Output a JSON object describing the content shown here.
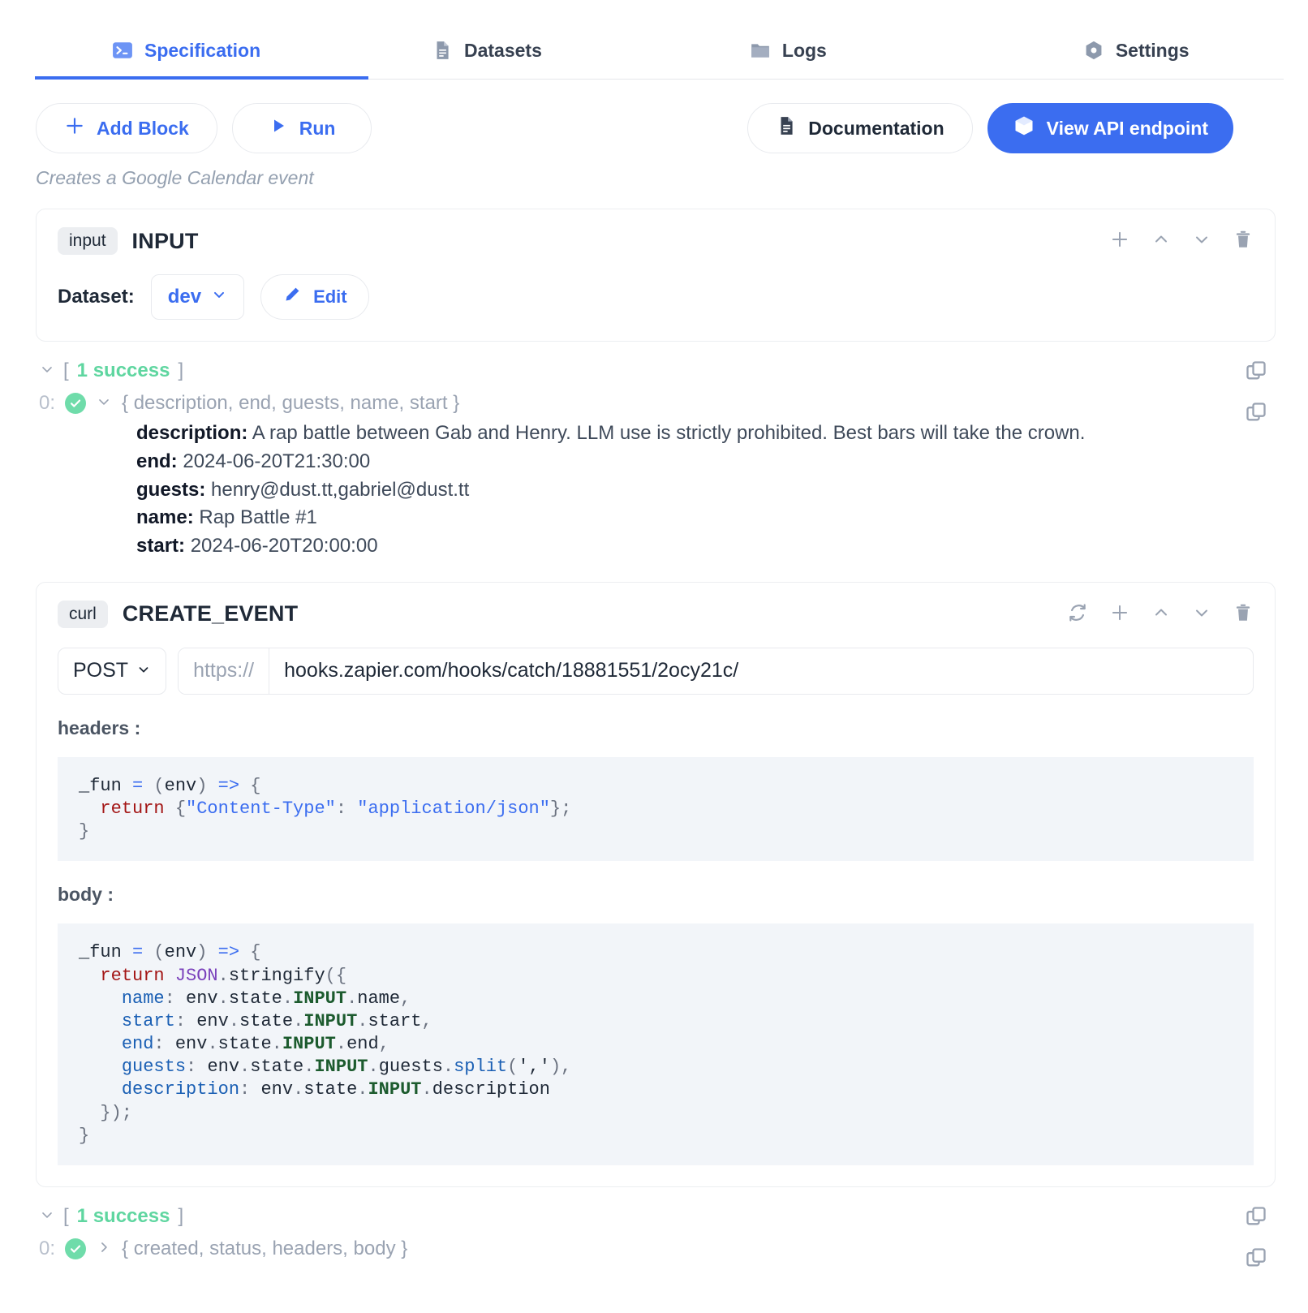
{
  "tabs": [
    {
      "label": "Specification",
      "icon": "terminal-icon",
      "active": true
    },
    {
      "label": "Datasets",
      "icon": "document-icon",
      "active": false
    },
    {
      "label": "Logs",
      "icon": "folder-icon",
      "active": false
    },
    {
      "label": "Settings",
      "icon": "hexagon-gear-icon",
      "active": false
    }
  ],
  "toolbar": {
    "add_block_label": "Add Block",
    "run_label": "Run",
    "documentation_label": "Documentation",
    "view_api_label": "View API endpoint"
  },
  "description": "Creates a Google Calendar event",
  "input_block": {
    "chip": "input",
    "name": "INPUT",
    "dataset_label": "Dataset:",
    "dataset_value": "dev",
    "edit_label": "Edit",
    "icons": [
      "plus-icon",
      "chevron-up-icon",
      "chevron-down-icon",
      "trash-icon"
    ]
  },
  "input_result": {
    "status": "1 success",
    "bracket_open": "[",
    "bracket_close": "]",
    "index": "0:",
    "keys_summary": "{ description, end, guests, name, start }",
    "fields": [
      {
        "key": "description:",
        "value": "A rap battle between Gab and Henry. LLM use is strictly prohibited. Best bars will take the crown."
      },
      {
        "key": "end:",
        "value": "2024-06-20T21:30:00"
      },
      {
        "key": "guests:",
        "value": "henry@dust.tt,gabriel@dust.tt"
      },
      {
        "key": "name:",
        "value": "Rap Battle #1"
      },
      {
        "key": "start:",
        "value": "2024-06-20T20:00:00"
      }
    ]
  },
  "curl_block": {
    "chip": "curl",
    "name": "CREATE_EVENT",
    "icons": [
      "refresh-icon",
      "plus-icon",
      "chevron-up-icon",
      "chevron-down-icon",
      "trash-icon"
    ],
    "method": "POST",
    "scheme": "https://",
    "url": "hooks.zapier.com/hooks/catch/18881551/2ocy21c/",
    "headers_label": "headers :",
    "body_label": "body :",
    "headers_code": "_fun = (env) => {\n  return {\"Content-Type\": \"application/json\"};\n}",
    "body_code": "_fun = (env) => {\n  return JSON.stringify({\n    name: env.state.INPUT.name,\n    start: env.state.INPUT.start,\n    end: env.state.INPUT.end,\n    guests: env.state.INPUT.guests.split(','),\n    description: env.state.INPUT.description\n  });\n}"
  },
  "curl_result": {
    "status": "1 success",
    "bracket_open": "[",
    "bracket_close": "]",
    "index": "0:",
    "keys_summary": "{ created, status, headers, body }"
  },
  "colors": {
    "accent": "#3b6df0",
    "success": "#5fd6a0",
    "muted": "#9aa3b2",
    "code_bg": "#f2f5f9"
  }
}
